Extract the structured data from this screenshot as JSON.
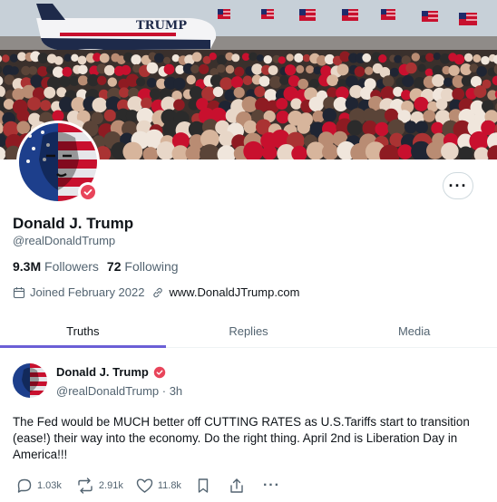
{
  "profile": {
    "name": "Donald J. Trump",
    "handle": "@realDonaldTrump",
    "followers_count": "9.3M",
    "followers_label": "Followers",
    "following_count": "72",
    "following_label": "Following",
    "joined": "Joined February 2022",
    "website": "www.DonaldJTrump.com"
  },
  "banner": {
    "plane_text": "TRUMP"
  },
  "tabs": [
    {
      "label": "Truths",
      "active": true
    },
    {
      "label": "Replies",
      "active": false
    },
    {
      "label": "Media",
      "active": false
    }
  ],
  "post": {
    "author": "Donald J. Trump",
    "handle_time": "@realDonaldTrump · 3h",
    "body": "The Fed would be MUCH better off CUTTING RATES as U.S.Tariffs start to transition (ease!) their way into the economy. Do the right thing. April 2nd is Liberation Day in America!!!",
    "replies": "1.03k",
    "retruths": "2.91k",
    "likes": "11.8k"
  },
  "colors": {
    "accent": "#6b5fd6",
    "verified": "#e8445a",
    "muted_text": "#536471"
  },
  "icons": [
    "more-icon",
    "calendar-icon",
    "link-icon",
    "verified-icon",
    "reply-icon",
    "retruth-icon",
    "like-icon",
    "bookmark-icon",
    "share-icon"
  ]
}
